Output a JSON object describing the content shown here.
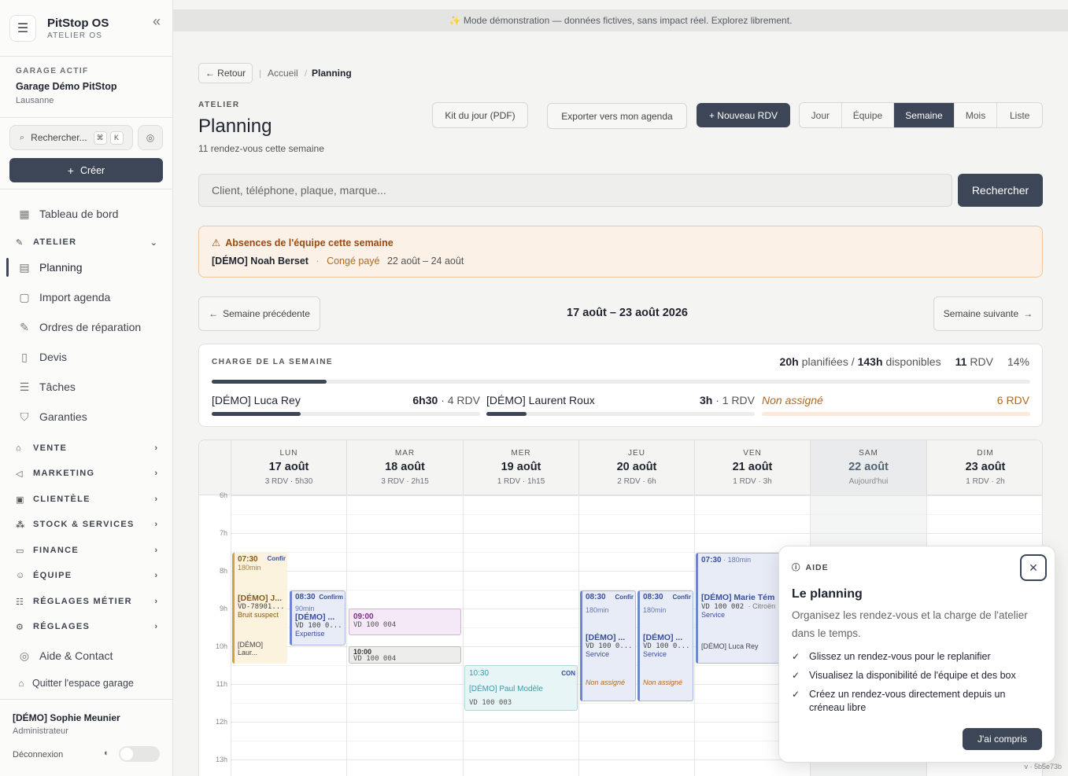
{
  "app": {
    "title": "PitStop OS",
    "subtitle": "ATELIER OS"
  },
  "garage": {
    "label": "GARAGE ACTIF",
    "name": "Garage Démo PitStop",
    "city": "Lausanne"
  },
  "sidebar": {
    "search_placeholder": "Rechercher...",
    "kbd1": "⌘",
    "kbd2": "K",
    "create_label": "Créer",
    "dashboard": "Tableau de bord",
    "atelier_section": "ATELIER",
    "atelier_items": [
      "Planning",
      "Import agenda",
      "Ordres de réparation",
      "Devis",
      "Tâches",
      "Garanties"
    ],
    "sections": [
      "VENTE",
      "MARKETING",
      "CLIENTÈLE",
      "STOCK & SERVICES",
      "FINANCE",
      "ÉQUIPE",
      "RÉGLAGES MÉTIER",
      "RÉGLAGES"
    ],
    "help_contact": "Aide & Contact",
    "quit": "Quitter l'espace garage",
    "user_name": "[DÉMO] Sophie Meunier",
    "user_role": "Administrateur",
    "logout": "Déconnexion"
  },
  "banner": "✨ Mode démonstration — données fictives, sans impact réel. Explorez librement.",
  "breadcrumb": {
    "back": "← Retour",
    "home": "Accueil",
    "current": "Planning"
  },
  "header": {
    "eyebrow": "ATELIER",
    "title": "Planning",
    "subtitle": "11 rendez-vous cette semaine"
  },
  "actions": {
    "kit": "Kit du jour (PDF)",
    "export": "Exporter vers mon agenda",
    "new": "+ Nouveau RDV"
  },
  "views": [
    "Jour",
    "Équipe",
    "Semaine",
    "Mois",
    "Liste"
  ],
  "active_view": "Semaine",
  "search": {
    "placeholder": "Client, téléphone, plaque, marque...",
    "button": "Rechercher"
  },
  "absences": {
    "title": "Absences de l'équipe cette semaine",
    "name": "[DÉMO] Noah Berset",
    "dot": "·",
    "type": "Congé payé",
    "dates": "22 août – 24 août"
  },
  "week": {
    "prev": "Semaine précédente",
    "label": "17 août – 23 août 2026",
    "next": "Semaine suivante"
  },
  "load": {
    "eyebrow": "CHARGE DE LA SEMAINE",
    "planned": "20h",
    "planned_txt": "planifiées /",
    "available": "143h",
    "available_txt": "disponibles",
    "rdv_count": "11",
    "rdv_txt": "RDV",
    "percent": "14%",
    "percent_value": 14,
    "techs": [
      {
        "name": "[DÉMO] Luca Rey",
        "hours": "6h30",
        "rdv": "· 4 RDV",
        "fill": 0.33
      },
      {
        "name": "[DÉMO] Laurent Roux",
        "hours": "3h",
        "rdv": "· 1 RDV",
        "fill": 0.15
      },
      {
        "name": "Non assigné",
        "hours": "",
        "rdv": "6 RDV",
        "fill": 0
      }
    ]
  },
  "calendar": {
    "days": [
      {
        "name": "LUN",
        "date": "17 août",
        "info": "3 RDV · 5h30"
      },
      {
        "name": "MAR",
        "date": "18 août",
        "info": "3 RDV · 2h15"
      },
      {
        "name": "MER",
        "date": "19 août",
        "info": "1 RDV · 1h15"
      },
      {
        "name": "JEU",
        "date": "20 août",
        "info": "2 RDV · 6h"
      },
      {
        "name": "VEN",
        "date": "21 août",
        "info": "1 RDV · 3h"
      },
      {
        "name": "SAM",
        "date": "22 août",
        "info": "Aujourd'hui"
      },
      {
        "name": "DIM",
        "date": "23 août",
        "info": "1 RDV · 2h"
      }
    ],
    "hours": [
      "6h",
      "7h",
      "8h",
      "9h",
      "10h",
      "11h",
      "12h",
      "13h"
    ],
    "events": {
      "mon1": {
        "time": "07:30",
        "dur": "180min",
        "status": "Confir",
        "name": "[DÉMO] J...",
        "plate": "VD-78901...",
        "note": "Bruit suspect",
        "tech": "[DÉMO] Laur..."
      },
      "mon2": {
        "time": "08:30",
        "dur": "90min",
        "status": "Confirm",
        "name": "[DÉMO] ...",
        "plate": "VD 100 0...",
        "note": "Expertise"
      },
      "tue1": {
        "time": "09:00",
        "plate": "VD 100 004"
      },
      "tue2": {
        "time": "10:00",
        "plate": "VD 100 004"
      },
      "wed1": {
        "time": "10:30",
        "status": "CON",
        "name": "[DÉMO] Paul Modèle",
        "plate": "VD 100 003"
      },
      "thu1": {
        "time": "08:30",
        "dur": "180min",
        "status": "Confir",
        "name": "[DÉMO] ...",
        "plate": "VD 100 0...",
        "note": "Service",
        "assign": "Non assigné"
      },
      "thu2": {
        "time": "08:30",
        "dur": "180min",
        "status": "Confir",
        "name": "[DÉMO] ...",
        "plate": "VD 100 0...",
        "note": "Service",
        "assign": "Non assigné"
      },
      "fri1": {
        "time": "07:30",
        "dur": "· 180min",
        "name": "[DÉMO] Marie Tém",
        "plate": "VD 100 002",
        "car": "· Citroën",
        "note": "Service",
        "tech": "[DÉMO] Luca Rey"
      }
    }
  },
  "help": {
    "eyebrow": "AIDE",
    "title": "Le planning",
    "desc": "Organisez les rendez-vous et la charge de l'atelier dans le temps.",
    "items": [
      "Glissez un rendez-vous pour le replanifier",
      "Visualisez la disponibilité de l'équipe et des box",
      "Créez un rendez-vous directement depuis un créneau libre"
    ],
    "ok": "J'ai compris"
  },
  "version": "v · 5b5e73b"
}
